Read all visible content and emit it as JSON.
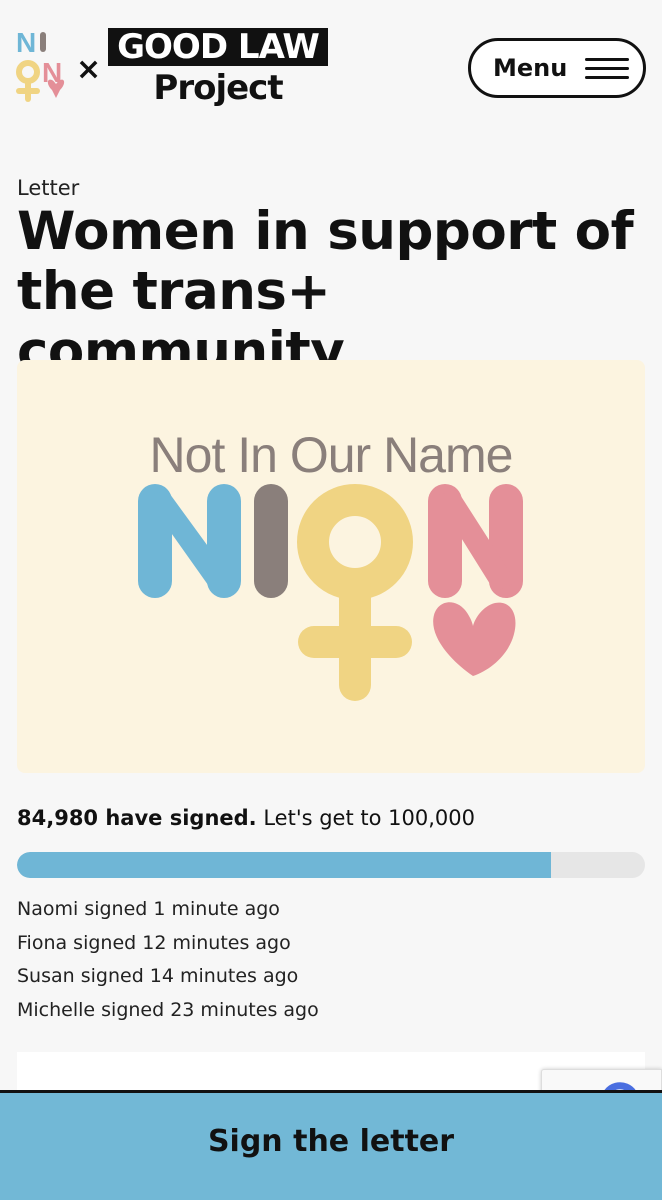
{
  "header": {
    "nion_logo_letters": [
      "N",
      "I",
      "O",
      "N"
    ],
    "separator": "×",
    "glp_line1": "GOOD LAW",
    "glp_line2": "Project",
    "menu_label": "Menu"
  },
  "page": {
    "kicker": "Letter",
    "title": "Women in support of the trans+ community"
  },
  "hero": {
    "tagline": "Not In Our Name",
    "letters": [
      "N",
      "I",
      "O",
      "N"
    ],
    "colors": {
      "background": "#fcf4e0",
      "blue": "#6fb6d6",
      "grey": "#8a7f7b",
      "yellow": "#f0d483",
      "pink": "#e48f98"
    }
  },
  "petition": {
    "signed_count": "84,980 have signed.",
    "goal_text": "Let's get to 100,000",
    "progress_fraction": 0.8498,
    "recent_signers": [
      {
        "name": "Naomi",
        "text": "signed 1 minute ago"
      },
      {
        "name": "Fiona",
        "text": "signed 12 minutes ago"
      },
      {
        "name": "Susan",
        "text": "signed 14 minutes ago"
      },
      {
        "name": "Michelle",
        "text": "signed 23 minutes ago"
      }
    ]
  },
  "cta": {
    "label": "Sign the letter"
  },
  "colors": {
    "accent": "#72b8d6",
    "progress_track": "#e6e6e6",
    "text": "#111111"
  }
}
